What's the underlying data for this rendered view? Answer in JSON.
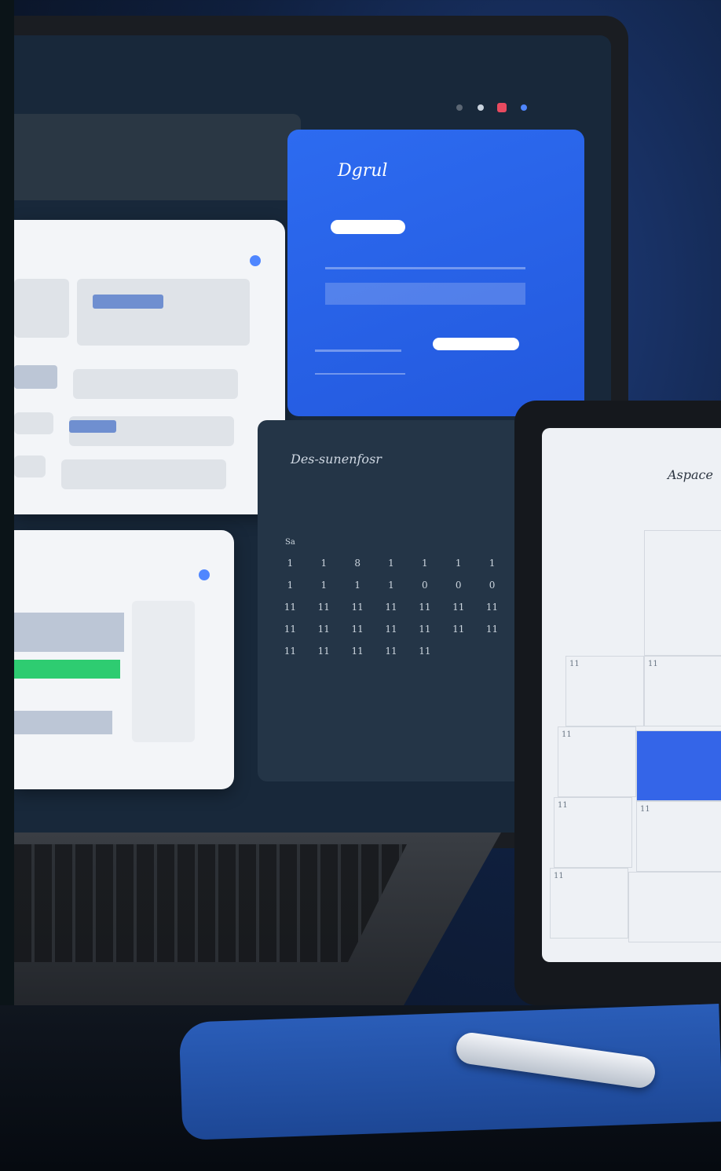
{
  "laptop": {
    "status_text": "",
    "blue_card": {
      "title": "Dgrul"
    },
    "calendar": {
      "title": "Des-sunenfosr",
      "month": "",
      "weekdays": [
        "Sa",
        "",
        "",
        "",
        "",
        "",
        ""
      ],
      "rows": [
        [
          "1",
          "1",
          "8",
          "1",
          "1",
          "1",
          "1"
        ],
        [
          "1",
          "1",
          "1",
          "1",
          "0",
          "0",
          "0"
        ],
        [
          "11",
          "11",
          "11",
          "11",
          "11",
          "11",
          "11"
        ],
        [
          "11",
          "11",
          "11",
          "11",
          "11",
          "11",
          "11"
        ],
        [
          "11",
          "11",
          "11",
          "11",
          "11",
          "",
          ""
        ]
      ]
    }
  },
  "tablet": {
    "title": "Aspace",
    "subtitle": "",
    "cells": [
      "11",
      "11",
      "11",
      "11",
      "11",
      "11"
    ]
  }
}
